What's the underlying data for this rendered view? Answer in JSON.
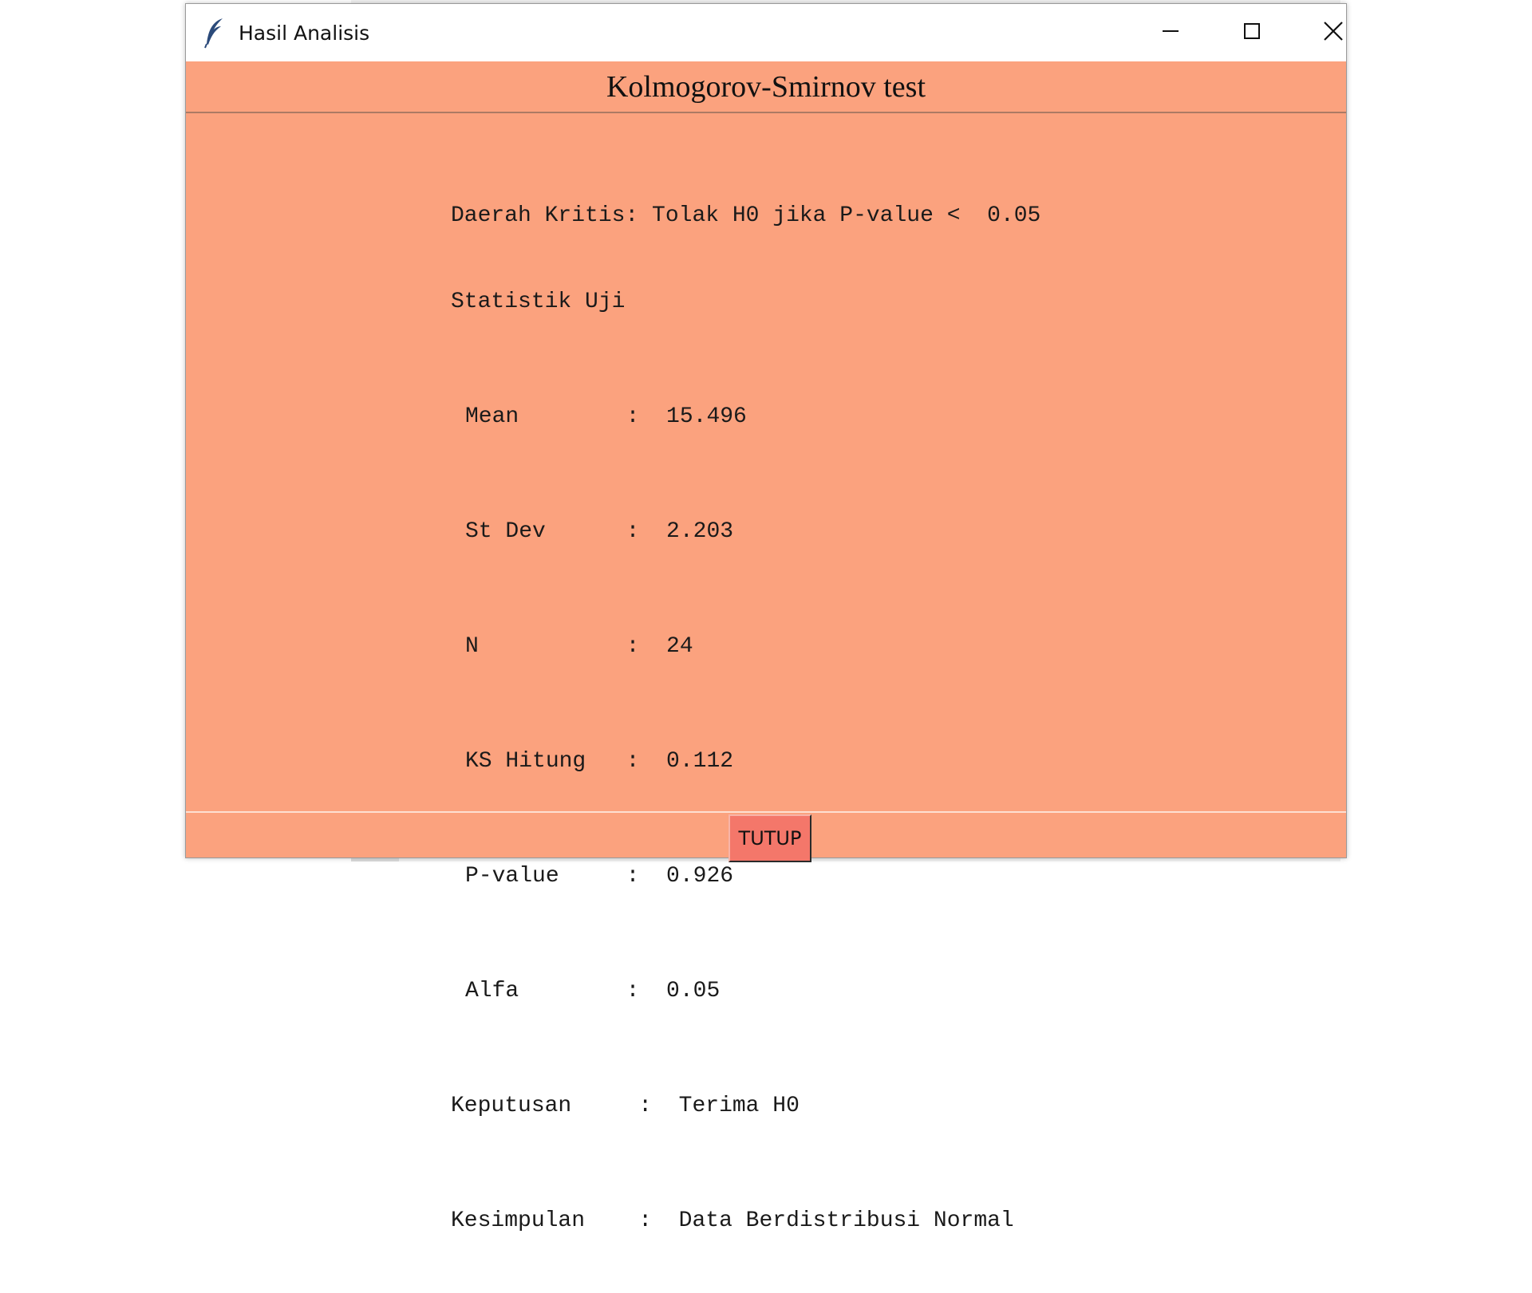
{
  "window": {
    "title": "Hasil Analisis"
  },
  "header": {
    "title": "Kolmogorov-Smirnov test"
  },
  "result": {
    "critical_region": "Daerah Kritis: Tolak H0 jika P-value <  0.05",
    "stat_heading": "Statistik Uji",
    "rows": [
      {
        "label": "Mean      ",
        "value": "15.496"
      },
      {
        "label": "St Dev    ",
        "value": "2.203"
      },
      {
        "label": "N         ",
        "value": "24"
      },
      {
        "label": "KS Hitung ",
        "value": "0.112"
      },
      {
        "label": "P-value   ",
        "value": "0.926"
      },
      {
        "label": "Alfa      ",
        "value": "0.05"
      }
    ],
    "decision": {
      "label": "Keputusan   ",
      "value": "Terima H0"
    },
    "conclusion": {
      "label": "Kesimpulan  ",
      "value": "Data Berdistribusi Normal"
    }
  },
  "footer": {
    "close_label": "TUTUP"
  },
  "icons": {
    "app": "feather-icon",
    "minimize": "minimize-icon",
    "maximize": "maximize-icon",
    "close": "close-icon"
  },
  "colors": {
    "background": "#fba27e",
    "button": "#f4776a"
  }
}
